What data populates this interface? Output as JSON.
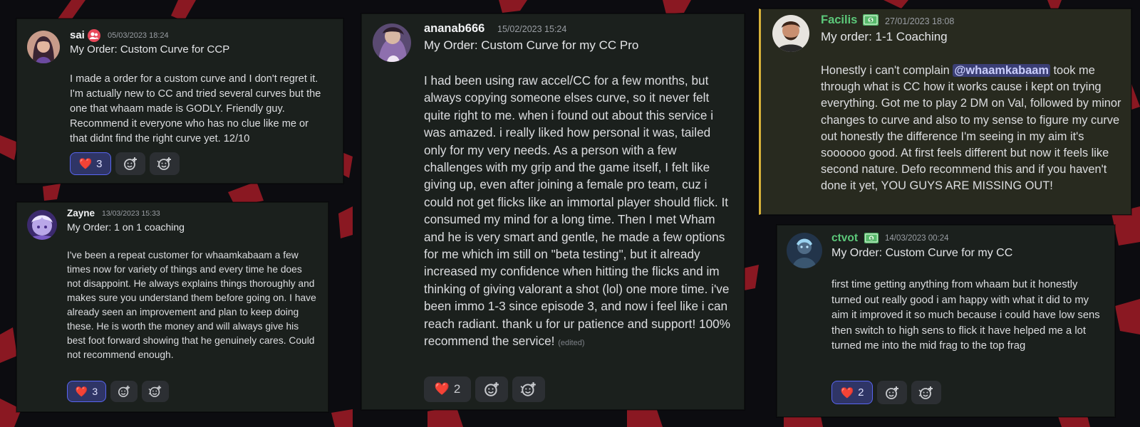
{
  "reviews": {
    "sai": {
      "username": "sai",
      "badge_icon": "members-badge-icon",
      "timestamp": "05/03/2023 18:24",
      "order": "My Order: Custom Curve for CCP",
      "message": "I made a order for a custom curve and I don't regret it. I'm actually new to CC and tried several curves but the one that whaam made is GODLY. Friendly guy. Recommend it everyone who has no clue like me or that didnt find the right curve yet. 12/10",
      "reaction_emoji": "❤️",
      "reaction_count": "3"
    },
    "zayne": {
      "username": "Zayne",
      "timestamp": "13/03/2023 15:33",
      "order": "My Order: 1 on 1  coaching",
      "message": "I've been a repeat customer for whaamkabaam a few times now for variety of things and every time he does not disappoint. He always explains things thoroughly and makes sure you understand them before going on. I have already seen an improvement and plan to keep doing these. He is worth the money and will always give his best foot forward showing that he genuinely cares. Could not recommend enough.",
      "reaction_emoji": "❤️",
      "reaction_count": "3"
    },
    "ananab": {
      "username": "ananab666",
      "timestamp": "15/02/2023 15:24",
      "order": "My Order: Custom Curve for my CC Pro",
      "message": "I had been using raw accel/CC for a few months, but always copying someone elses curve, so it never felt quite right to me. when i found out about this service i was amazed. i really liked how personal it was, tailed only for my very needs. As a person with a few challenges with my grip and the game itself, I felt like giving up, even after joining a female pro team, cuz i could not get flicks like an immortal player should flick. It consumed my mind for a long time. Then I met Wham and he is very smart and gentle, he made a few options for me which im still on \"beta testing\", but it already increased my confidence when hitting the flicks and im thinking of giving valorant a shot (lol) one more time. i've been immo 1-3 since episode 3, and now i feel like i can reach radiant. thank u for ur patience and support! 100% recommend the service!",
      "edited": "(edited)",
      "reaction_emoji": "❤️",
      "reaction_count": "2"
    },
    "facilis": {
      "username": "Facilis",
      "badge_icon": "money-badge-icon",
      "timestamp": "27/01/2023 18:08",
      "order": "My order: 1-1 Coaching",
      "message_before": "Honestly i can't complain ",
      "mention": "@whaamkabaam",
      "message_after": " took me through what is CC how it works cause i kept on trying everything. Got me to play 2 DM on Val, followed by minor changes to curve and also to my sense to figure my curve out honestly the difference I'm seeing in my aim it's soooooo good. At first feels different but now it feels like second nature. Defo recommend this and if you haven't done it yet, YOU GUYS ARE MISSING OUT!"
    },
    "ctvot": {
      "username": "ctvot",
      "badge_icon": "money-badge-icon",
      "timestamp": "14/03/2023 00:24",
      "order": "My Order: Custom Curve for my CC",
      "message": "first time getting anything from whaam but it honestly turned out really good i am happy with what it did to my aim it improved it so much because i could have low sens then switch to high sens to flick it have helped me a lot turned me into the mid frag to the top frag",
      "reaction_emoji": "❤️",
      "reaction_count": "2"
    }
  },
  "colors": {
    "background": "#0c0c10",
    "background_stripes": "#8a1822",
    "card": "#1b201d",
    "highlight_card": "#282a1f",
    "highlight_bar": "#d7b13a",
    "username_green": "#5cc87a",
    "reaction_active_border": "#5865f2",
    "mention": "#3b3f75"
  }
}
